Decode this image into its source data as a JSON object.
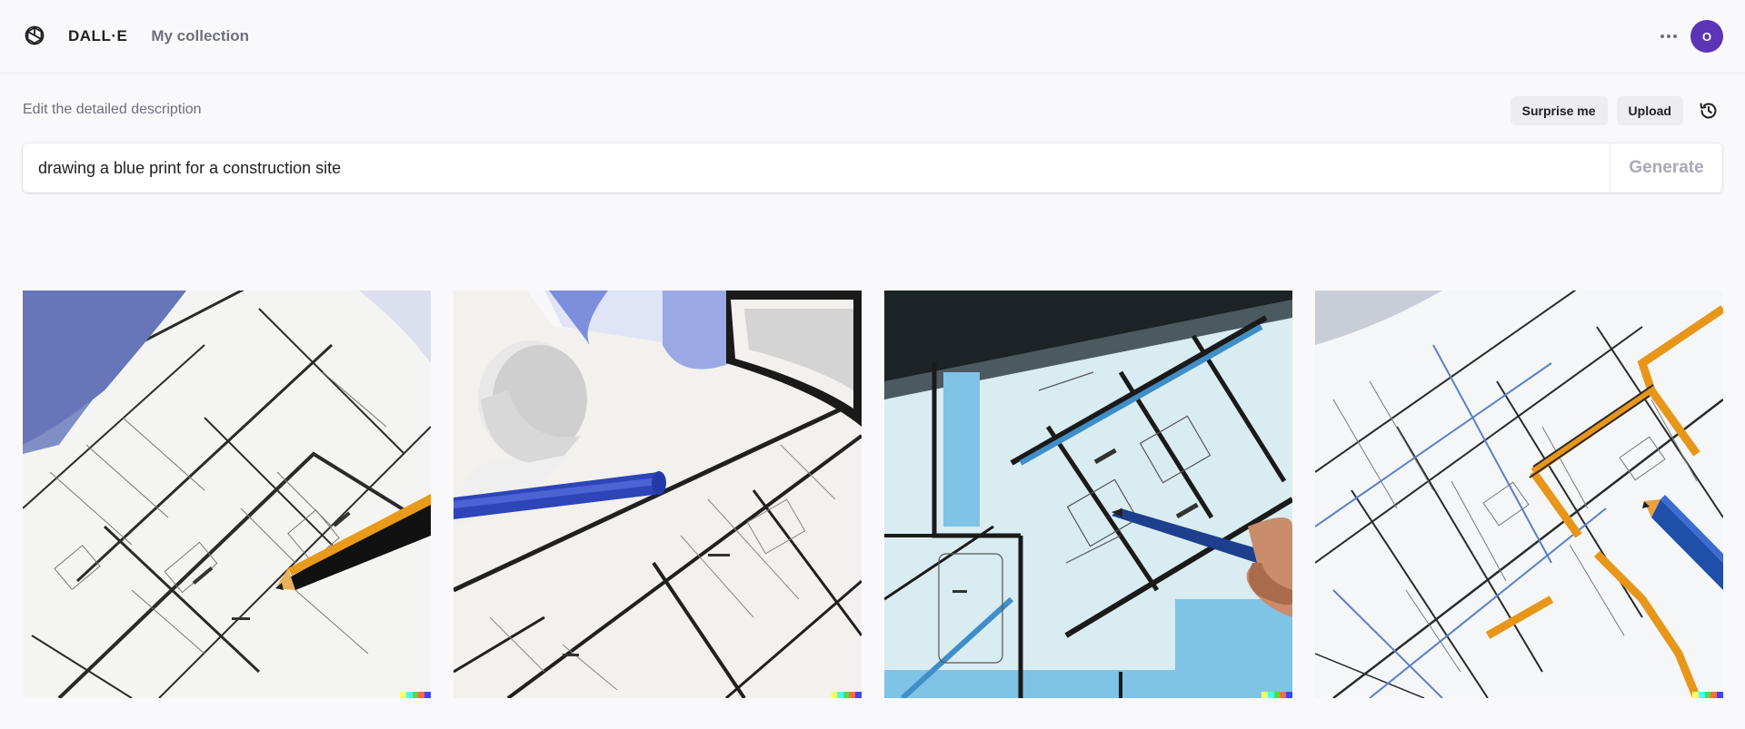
{
  "header": {
    "brand": "DALL·E",
    "nav_collection": "My collection",
    "avatar_initial": "O"
  },
  "prompt": {
    "label": "Edit the detailed description",
    "value": "drawing a blue print for a construction site",
    "surprise_label": "Surprise me",
    "upload_label": "Upload",
    "generate_label": "Generate"
  },
  "images": [
    {
      "name": "blueprint-sketch-with-pencil"
    },
    {
      "name": "blueprint-with-glasses-and-pen"
    },
    {
      "name": "blue-floor-plan-with-hand"
    },
    {
      "name": "blueprint-with-orange-pencil"
    }
  ],
  "colors": {
    "avatar": "#5b34b8",
    "signature": [
      "#ffff66",
      "#42ffff",
      "#51da4c",
      "#ff6e3c",
      "#3c46ff"
    ]
  }
}
